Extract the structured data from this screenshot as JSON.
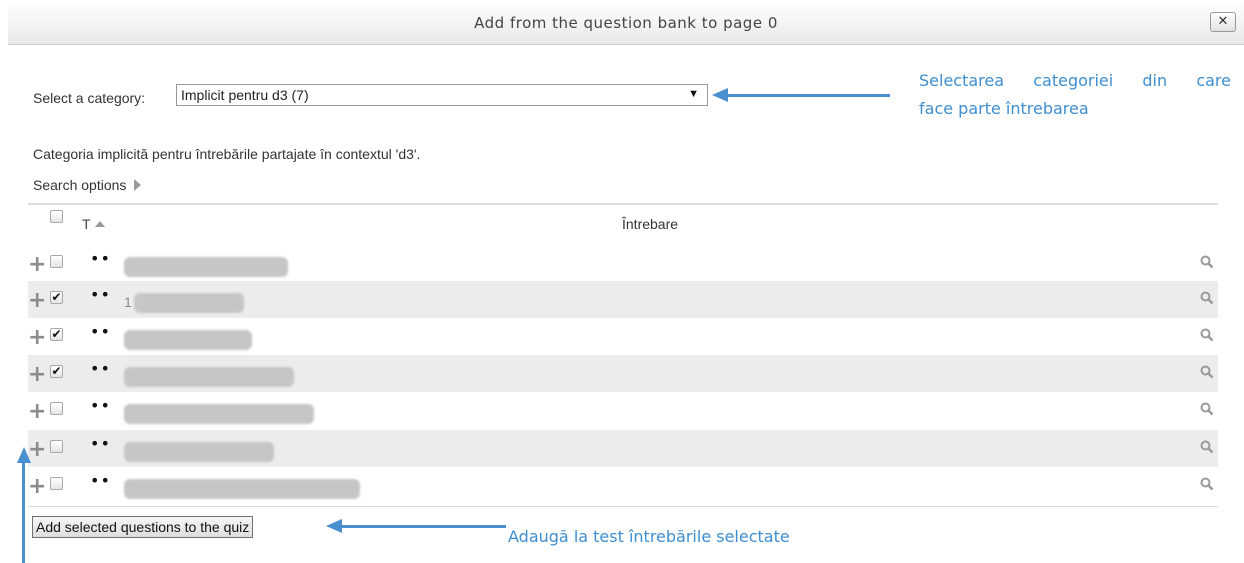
{
  "dialog": {
    "title": "Add from the question bank to page 0",
    "close_label": "✕"
  },
  "category": {
    "label": "Select a category:",
    "selected": "Implicit pentru d3 (7)",
    "description": "Categoria implicită pentru întrebările partajate în contextul 'd3'."
  },
  "search_options": {
    "label": "Search options"
  },
  "table": {
    "col_type": "T",
    "col_question": "Întrebare",
    "rows": [
      {
        "checked": false,
        "type": "••",
        "text": ""
      },
      {
        "checked": true,
        "type": "••",
        "text": "1"
      },
      {
        "checked": true,
        "type": "••",
        "text": ""
      },
      {
        "checked": true,
        "type": "••",
        "text": ""
      },
      {
        "checked": false,
        "type": "••",
        "text": ""
      },
      {
        "checked": false,
        "type": "••",
        "text": ""
      },
      {
        "checked": false,
        "type": "••",
        "text": ""
      }
    ]
  },
  "add_button": {
    "label": "Add selected questions to the quiz"
  },
  "annotations": {
    "category_note_line1": "Selectarea categoriei din care",
    "category_note_line2": "face parte întrebarea",
    "add_note": "Adaugă la test întrebările selectate"
  },
  "colors": {
    "annotation": "#3e8ed0",
    "row_shade": "#ececec"
  },
  "icons": {
    "add": "plus-icon",
    "preview": "magnifier-icon",
    "sort": "sort-up-icon",
    "expand": "triangle-right-icon"
  }
}
